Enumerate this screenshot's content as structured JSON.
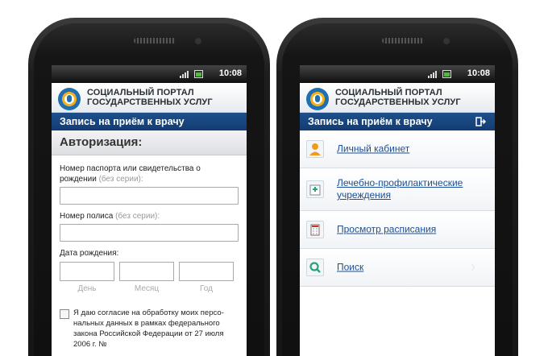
{
  "status": {
    "time": "10:08"
  },
  "header": {
    "portal_title_line1": "СОЦИАЛЬНЫЙ ПОРТАЛ",
    "portal_title_line2": "ГОСУДАРСТВЕННЫХ УСЛУГ"
  },
  "titlebar": {
    "text": "Запись на приём к врачу"
  },
  "login": {
    "heading": "Авторизация:",
    "passport_label": "Номер паспорта или свидетельства о рождении",
    "passport_hint": "(без серии):",
    "policy_label": "Номер полиса",
    "policy_hint": "(без серии):",
    "birth_label": "Дата рождения:",
    "day_label": "День",
    "month_label": "Месяц",
    "year_label": "Год",
    "consent_text": "Я даю согласие на обработку моих персо-нальных данных в рамках федерального закона Российской Федерации от 27 июля 2006 г. №"
  },
  "menu": {
    "items": [
      {
        "label": "Личный кабинет",
        "icon": "person-icon"
      },
      {
        "label": "Лечебно-профилактические учреждения",
        "icon": "hospital-icon"
      },
      {
        "label": "Просмотр расписания",
        "icon": "calendar-icon"
      },
      {
        "label": "Поиск",
        "icon": "search-icon"
      }
    ]
  },
  "colors": {
    "accent": "#1b4f96",
    "titlebar": "#1d4f8c",
    "person_icon": "#f39a1d",
    "search_icon": "#2aa176"
  }
}
